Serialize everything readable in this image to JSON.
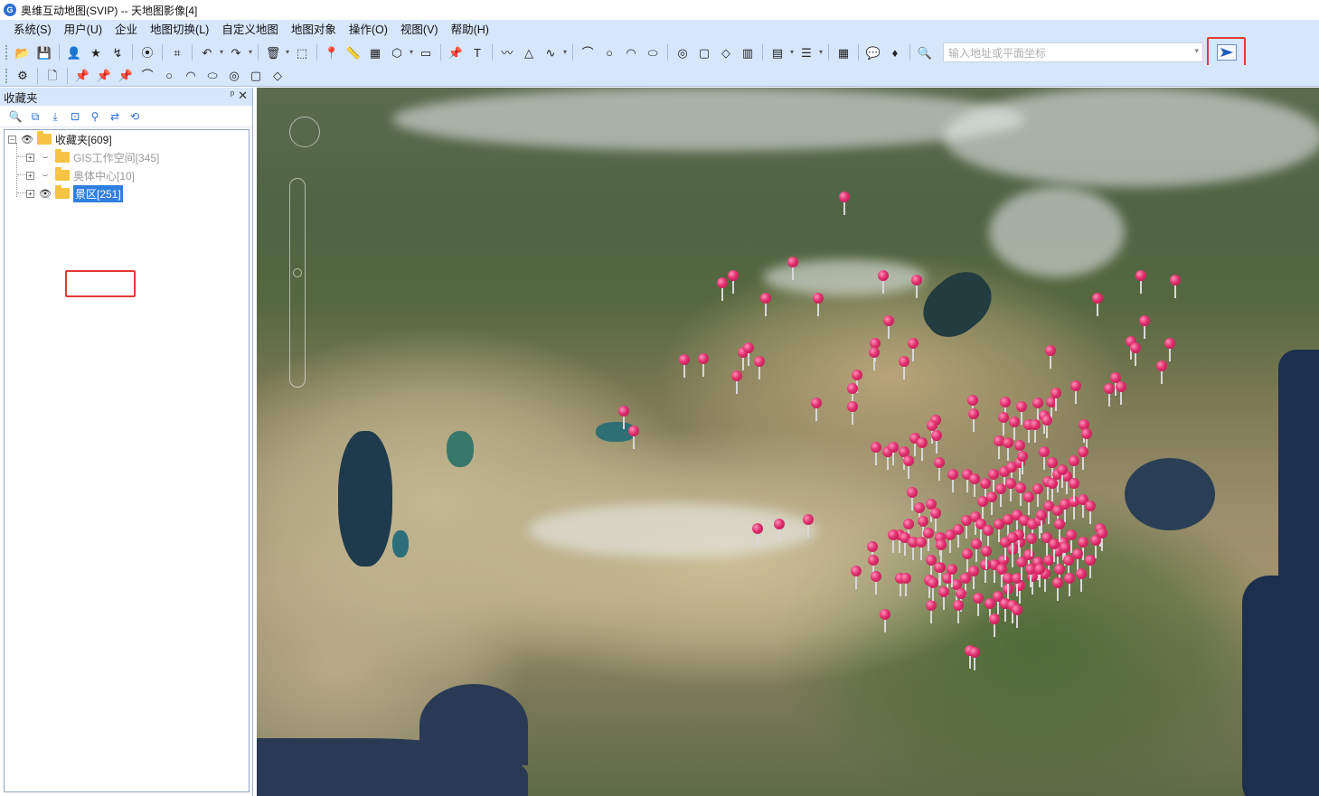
{
  "window": {
    "title": "奥维互动地图(SVIP) -- 天地图影像[4]",
    "app_icon_letter": "G"
  },
  "menu": [
    "系统(S)",
    "用户(U)",
    "企业",
    "地图切换(L)",
    "自定义地图",
    "地图对象",
    "操作(O)",
    "视图(V)",
    "帮助(H)"
  ],
  "toolbar1_icons": [
    "open-folder-icon",
    "save-icon",
    "sep",
    "user-icon",
    "star-icon",
    "route-icon",
    "sep",
    "3d-icon",
    "sep",
    "crop-icon",
    "sep",
    "undo-icon",
    "caret",
    "redo-icon",
    "caret",
    "sep",
    "delete-icon",
    "caret",
    "select-rect-icon",
    "sep",
    "place-marker-icon",
    "ruler-icon",
    "area-measure-icon",
    "polygon-icon",
    "caret",
    "camera-icon",
    "sep",
    "pin-icon",
    "text-icon",
    "sep",
    "line-icon",
    "triangle-icon",
    "curve-icon",
    "caret",
    "sep",
    "arc-icon",
    "circle-icon",
    "arc2-icon",
    "ellipse-icon",
    "sep",
    "circle-fill-icon",
    "square-fill-icon",
    "shape-icon",
    "bar-icon",
    "sep",
    "layers-icon",
    "caret",
    "list-icon",
    "caret",
    "sep",
    "grid-icon",
    "sep",
    "chat-icon",
    "vip-icon",
    "sep",
    "search-icon"
  ],
  "toolbar1_glyphs": {
    "open-folder-icon": "📂",
    "save-icon": "💾",
    "user-icon": "👤",
    "star-icon": "★",
    "route-icon": "↯",
    "3d-icon": "⦿",
    "crop-icon": "⌗",
    "undo-icon": "↶",
    "redo-icon": "↷",
    "delete-icon": "🗑",
    "select-rect-icon": "⬚",
    "place-marker-icon": "📍",
    "ruler-icon": "📏",
    "area-measure-icon": "▦",
    "polygon-icon": "⬡",
    "camera-icon": "▭",
    "pin-icon": "📌",
    "text-icon": "T",
    "line-icon": "〰",
    "triangle-icon": "△",
    "curve-icon": "∿",
    "arc-icon": "⌒",
    "circle-icon": "○",
    "arc2-icon": "◠",
    "ellipse-icon": "⬭",
    "circle-fill-icon": "◎",
    "square-fill-icon": "▢",
    "shape-icon": "◇",
    "bar-icon": "▥",
    "layers-icon": "▤",
    "list-icon": "☰",
    "grid-icon": "▦",
    "chat-icon": "💬",
    "vip-icon": "♦",
    "search-icon": "🔍",
    "caret": "▾"
  },
  "toolbar2_icons": [
    "gear-icon",
    "sep",
    "page-icon",
    "sep",
    "pushpin-yellow-icon",
    "pushpin-blue-icon",
    "pushpin-green-icon",
    "arc-icon",
    "circle-icon",
    "arc2-icon",
    "ellipse-icon",
    "circle-fill-icon",
    "square-fill-icon",
    "shape-icon"
  ],
  "toolbar2_glyphs": {
    "gear-icon": "⚙",
    "page-icon": "🗋",
    "pushpin-yellow-icon": "📌",
    "pushpin-blue-icon": "📌",
    "pushpin-green-icon": "📌",
    "arc-icon": "⌒",
    "circle-icon": "○",
    "arc2-icon": "◠",
    "ellipse-icon": "⬭",
    "circle-fill-icon": "◎",
    "square-fill-icon": "▢",
    "shape-icon": "◇"
  },
  "search": {
    "placeholder": "输入地址或平面坐标",
    "value": ""
  },
  "panel": {
    "title": "收藏夹",
    "pin_glyph": "ᵖ",
    "close_glyph": "✕",
    "tool_glyphs": [
      "🔍",
      "⧉",
      "⤓",
      "⊡",
      "⚲",
      "⇄",
      "⟲"
    ],
    "tree": {
      "root": {
        "label": "收藏夹[609]",
        "expander": "−"
      },
      "children": [
        {
          "label": "GIS工作空间[345]",
          "expander": "+",
          "visible": false
        },
        {
          "label": "奥体中心[10]",
          "expander": "+",
          "visible": false
        },
        {
          "label": "景区[251]",
          "expander": "+",
          "visible": true,
          "selected": true
        }
      ]
    }
  },
  "map": {
    "layer": "天地图影像",
    "marker_color": "#e0306d"
  }
}
